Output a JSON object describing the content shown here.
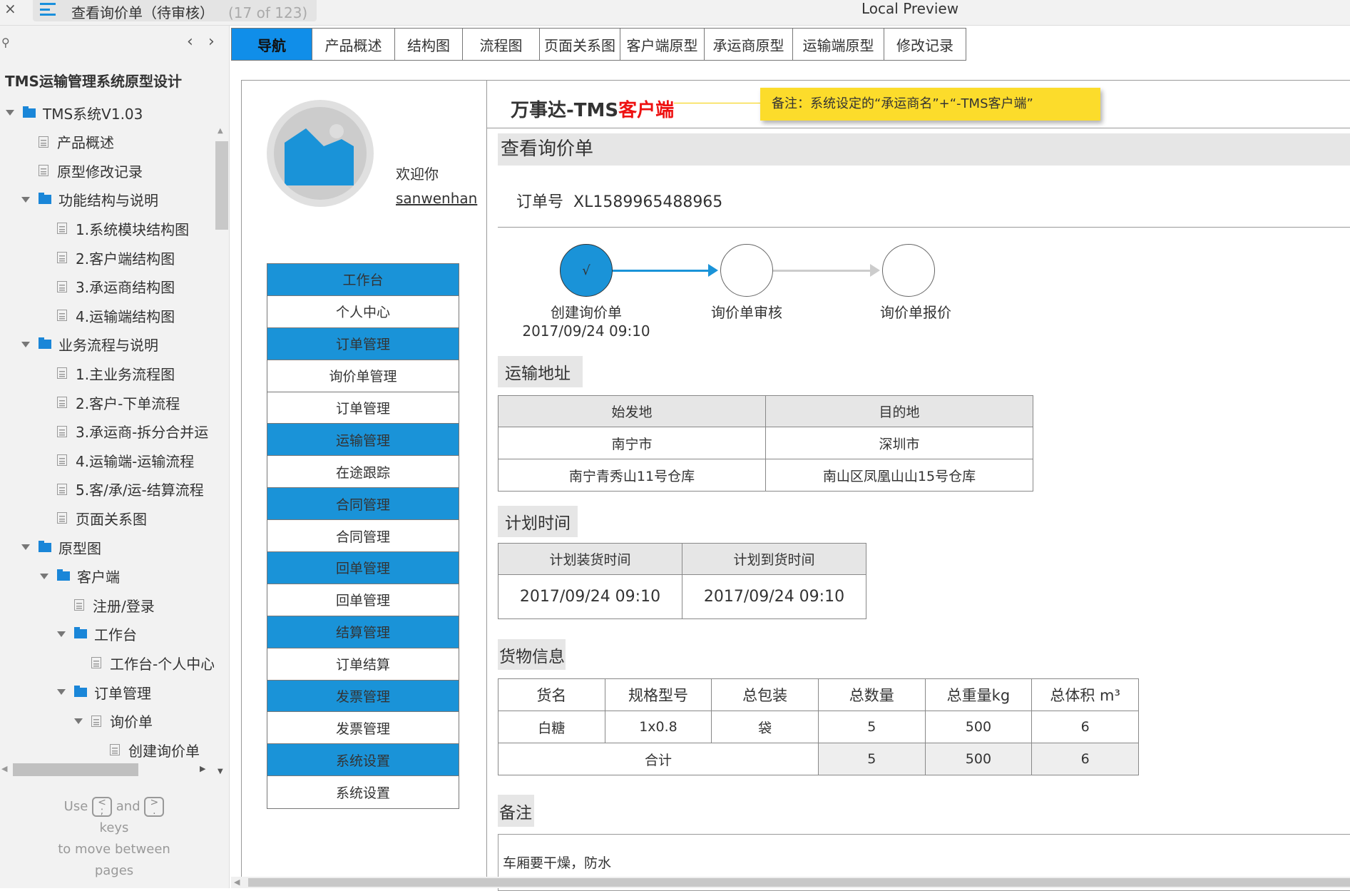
{
  "window": {
    "title": "查看询价单（待审核）",
    "count": "(17 of 123)",
    "preview": "Local Preview",
    "close_icon": "close-icon"
  },
  "sidebar": {
    "title": "TMS运输管理系统原型设计",
    "tree": [
      {
        "label": "TMS系统V1.03",
        "level": 0,
        "type": "folder",
        "open": true
      },
      {
        "label": "产品概述",
        "level": 1,
        "type": "page"
      },
      {
        "label": "原型修改记录",
        "level": 1,
        "type": "page"
      },
      {
        "label": "功能结构与说明",
        "level": 1,
        "type": "folder",
        "open": true
      },
      {
        "label": "1.系统模块结构图",
        "level": 2,
        "type": "page"
      },
      {
        "label": "2.客户端结构图",
        "level": 2,
        "type": "page"
      },
      {
        "label": "3.承运商结构图",
        "level": 2,
        "type": "page"
      },
      {
        "label": "4.运输端结构图",
        "level": 2,
        "type": "page"
      },
      {
        "label": "业务流程与说明",
        "level": 1,
        "type": "folder",
        "open": true
      },
      {
        "label": "1.主业务流程图",
        "level": 2,
        "type": "page"
      },
      {
        "label": "2.客户-下单流程",
        "level": 2,
        "type": "page"
      },
      {
        "label": "3.承运商-拆分合并运",
        "level": 2,
        "type": "page"
      },
      {
        "label": "4.运输端-运输流程",
        "level": 2,
        "type": "page"
      },
      {
        "label": "5.客/承/运-结算流程",
        "level": 2,
        "type": "page"
      },
      {
        "label": "页面关系图",
        "level": 2,
        "type": "page"
      },
      {
        "label": "原型图",
        "level": 1,
        "type": "folder",
        "open": true
      },
      {
        "label": "客户端",
        "level": 2,
        "type": "folder",
        "open": true
      },
      {
        "label": "注册/登录",
        "level": 3,
        "type": "page"
      },
      {
        "label": "工作台",
        "level": 3,
        "type": "folder",
        "open": true
      },
      {
        "label": "工作台-个人中心",
        "level": 4,
        "type": "page"
      },
      {
        "label": "订单管理",
        "level": 3,
        "type": "folder",
        "open": true
      },
      {
        "label": "询价单",
        "level": 4,
        "type": "page",
        "open": true
      },
      {
        "label": "创建询价单",
        "level": 5,
        "type": "page"
      }
    ],
    "hint": {
      "use": "Use",
      "key1": "<\n;",
      "and": "and",
      "key2": ">\n.",
      "keys": "keys",
      "move": "to move between",
      "pages": "pages"
    }
  },
  "nav_tabs": [
    "导航",
    "产品概述",
    "结构图",
    "流程图",
    "页面关系图",
    "客户端原型",
    "承运商原型",
    "运输端原型",
    "修改记录"
  ],
  "user": {
    "welcome": "欢迎你",
    "name": "sanwenhan"
  },
  "menu": [
    {
      "label": "工作台",
      "header": true
    },
    {
      "label": "个人中心"
    },
    {
      "label": "订单管理",
      "header": true
    },
    {
      "label": "询价单管理"
    },
    {
      "label": "订单管理"
    },
    {
      "label": "运输管理",
      "header": true
    },
    {
      "label": "在途跟踪"
    },
    {
      "label": "合同管理",
      "header": true
    },
    {
      "label": "合同管理"
    },
    {
      "label": "回单管理",
      "header": true
    },
    {
      "label": "回单管理"
    },
    {
      "label": "结算管理",
      "header": true
    },
    {
      "label": "订单结算"
    },
    {
      "label": "发票管理",
      "header": true
    },
    {
      "label": "发票管理"
    },
    {
      "label": "系统设置",
      "header": true
    },
    {
      "label": "系统设置"
    }
  ],
  "brand": {
    "prefix": "万事达-TMS",
    "suffix": "客户端",
    "note": "备注：系统设定的“承运商名”+“-TMS客户端”"
  },
  "page": {
    "section_title": "查看询价单",
    "order_label": "订单号",
    "order_no": "XL1589965488965",
    "steps": [
      {
        "label": "创建询价单",
        "date": "2017/09/24  09:10",
        "done": true,
        "mark": "√"
      },
      {
        "label": "询价单审核",
        "done": false
      },
      {
        "label": "询价单报价",
        "done": false
      }
    ],
    "address": {
      "title": "运输地址",
      "headers": [
        "始发地",
        "目的地"
      ],
      "rows": [
        [
          "南宁市",
          "深圳市"
        ],
        [
          "南宁青秀山11号仓库",
          "南山区凤凰山山15号仓库"
        ]
      ]
    },
    "plan": {
      "title": "计划时间",
      "headers": [
        "计划装货时间",
        "计划到货时间"
      ],
      "rows": [
        [
          "2017/09/24  09:10",
          "2017/09/24  09:10"
        ]
      ]
    },
    "goods": {
      "title": "货物信息",
      "headers": [
        "货名",
        "规格型号",
        "总包装",
        "总数量",
        "总重量kg",
        "总体积 m³"
      ],
      "rows": [
        [
          "白糖",
          "1x0.8",
          "袋",
          "5",
          "500",
          "6"
        ]
      ],
      "total": {
        "label": "合计",
        "values": [
          "5",
          "500",
          "6"
        ]
      }
    },
    "remark": {
      "title": "备注",
      "text": "车厢要干燥，防水"
    }
  },
  "colors": {
    "accent": "#1a93d8",
    "active_tab": "#108ee9",
    "brand_red": "#ee1111",
    "note_yellow": "#fcdc2b"
  }
}
